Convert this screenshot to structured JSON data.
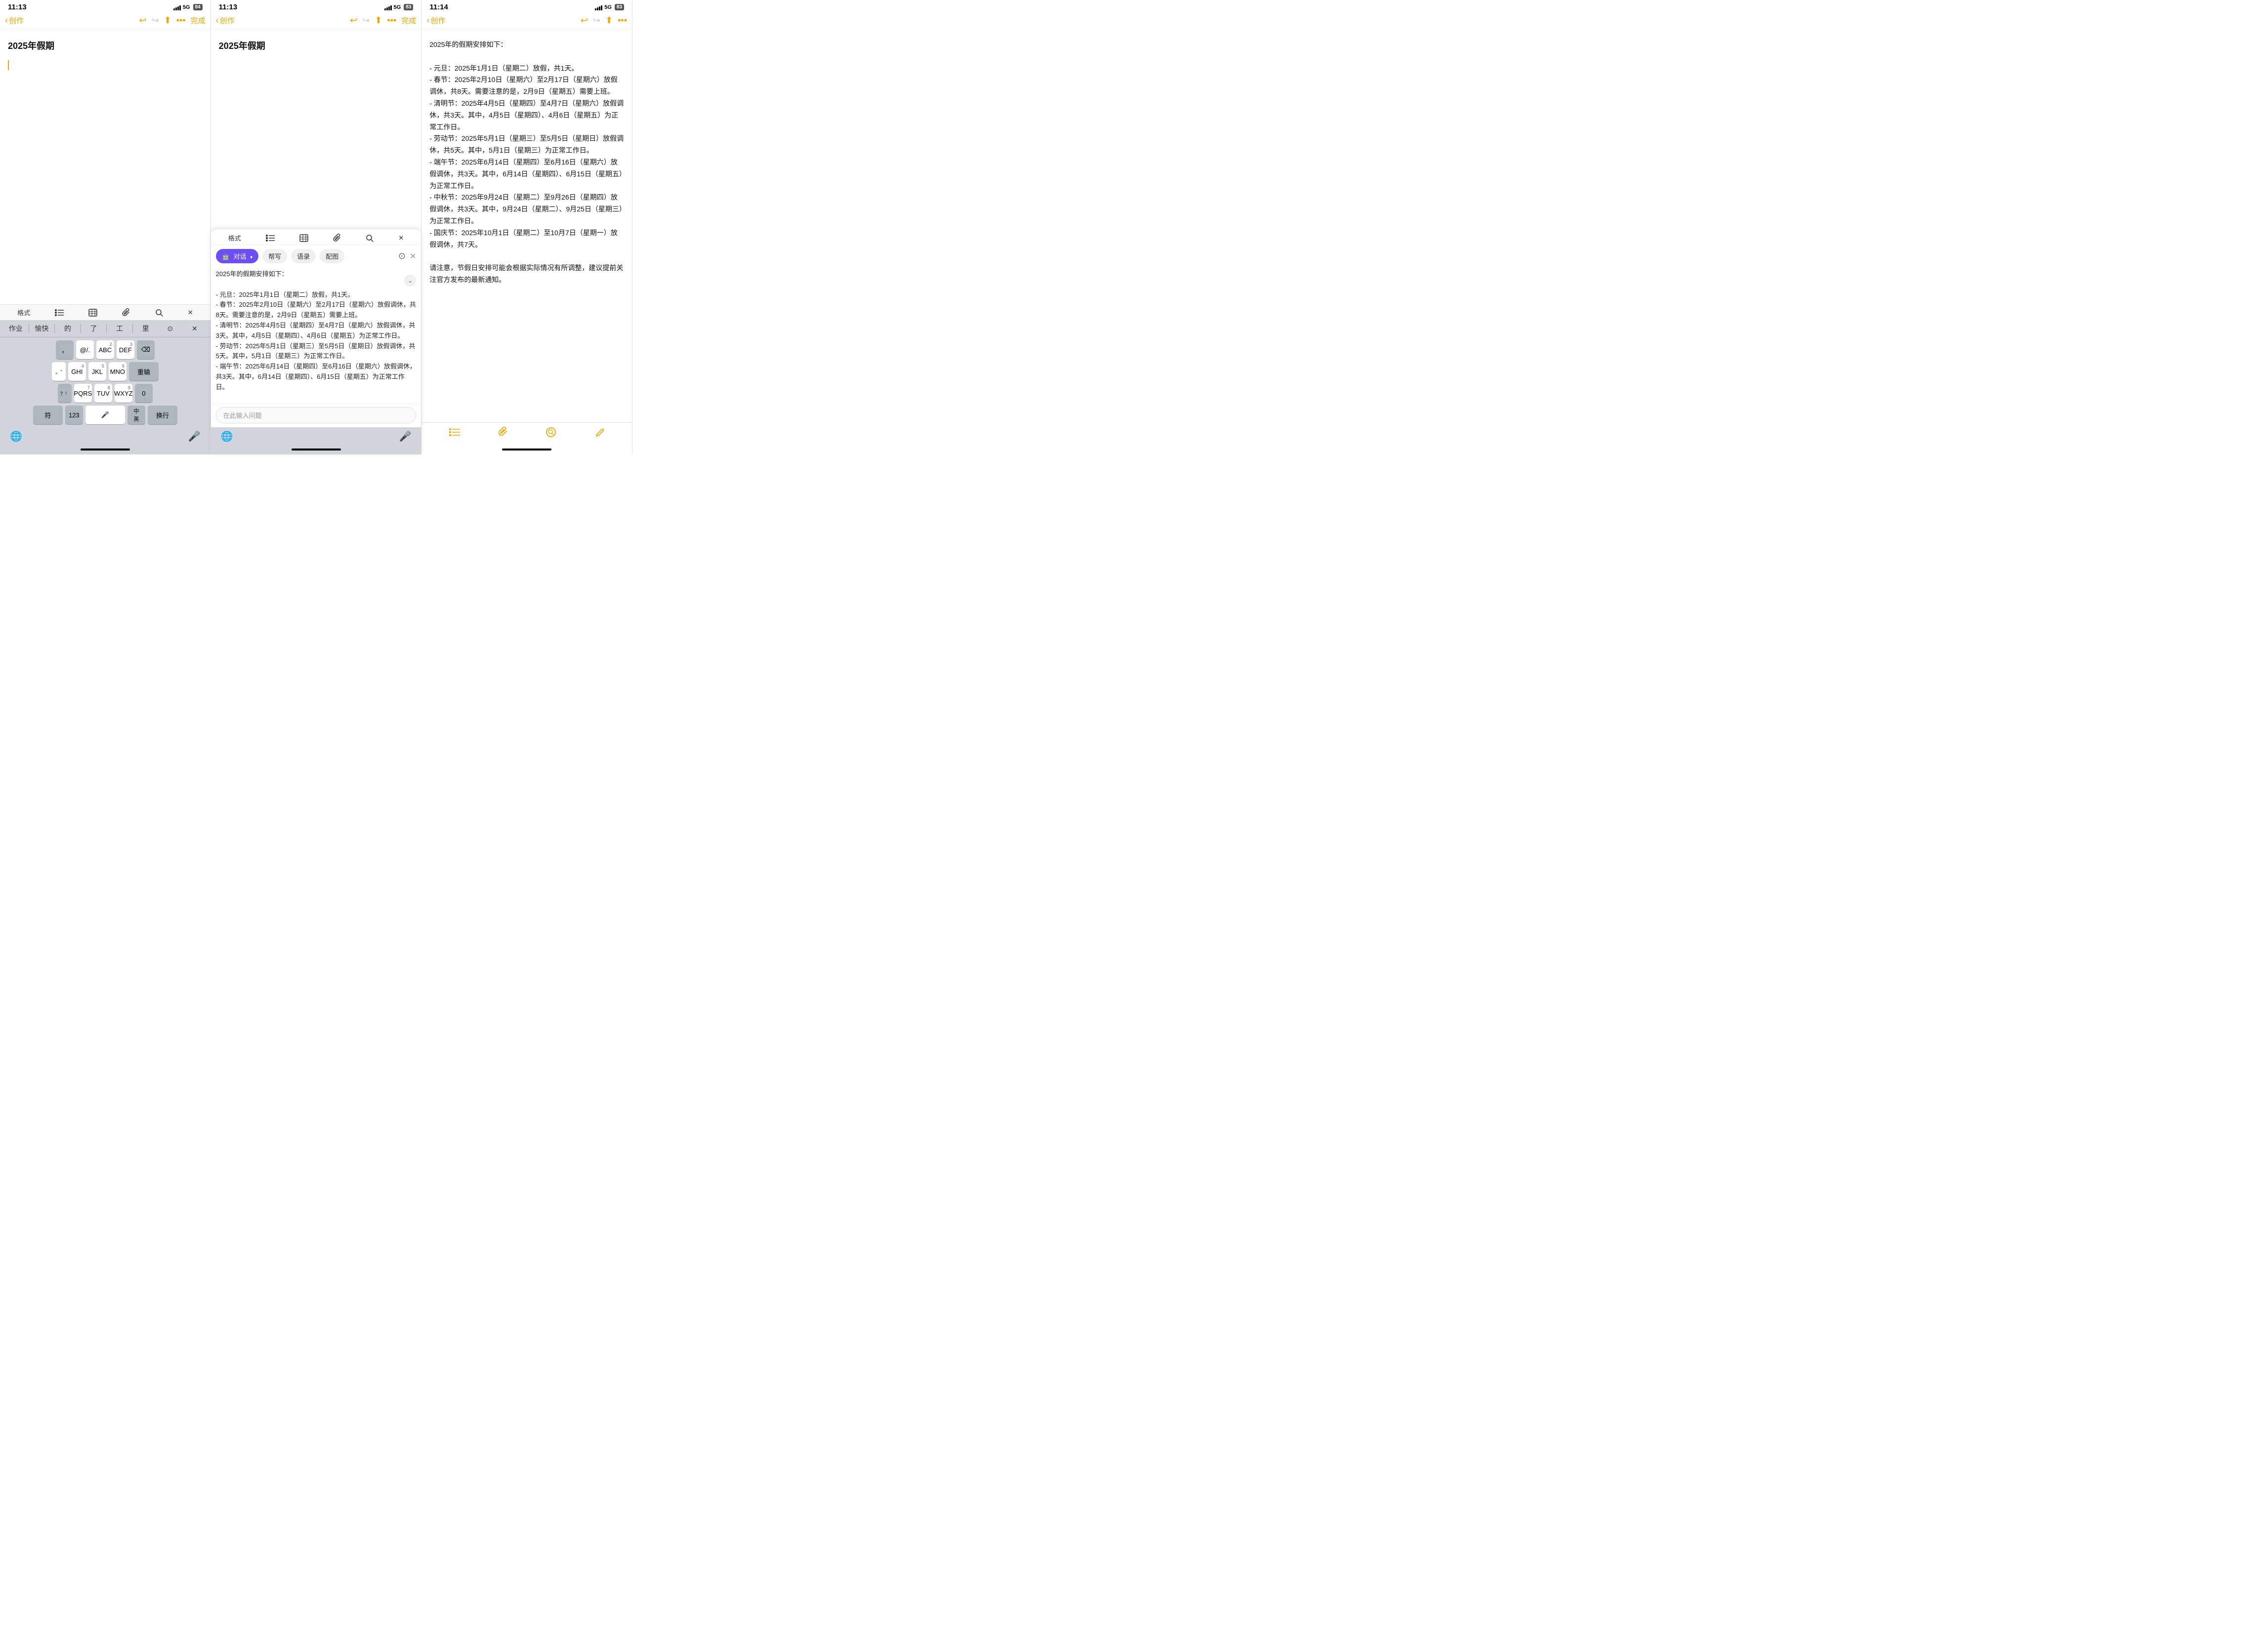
{
  "panels": [
    {
      "id": "panel1",
      "status": {
        "time": "11:13",
        "signal_label": "5G",
        "battery": "84"
      },
      "nav": {
        "back_label": "创作",
        "done_label": "完成"
      },
      "note": {
        "title": "2025年假期",
        "body": ""
      },
      "format_toolbar": [
        "格式",
        "列表",
        "表格",
        "附件",
        "搜索",
        "关闭"
      ],
      "keyboard": {
        "suggestions": [
          "作业",
          "愉快",
          "的",
          "了",
          "工",
          "里"
        ],
        "rows": [
          [
            "，",
            "@/.",
            "ABC",
            "DEF",
            "⌫"
          ],
          [
            "GHI",
            "JKL",
            "MNO",
            "重输"
          ],
          [
            "PQRS",
            "TUV",
            "WXYZ",
            "0"
          ],
          [
            "符",
            "123",
            "🎤",
            "中英",
            "换行"
          ]
        ]
      }
    },
    {
      "id": "panel2",
      "status": {
        "time": "11:13",
        "signal_label": "5G",
        "battery": "83"
      },
      "nav": {
        "back_label": "创作",
        "done_label": "完成"
      },
      "note": {
        "title": "2025年假期",
        "body": ""
      },
      "chat": {
        "toolbar": [
          "格式",
          "列表",
          "表格",
          "附件",
          "搜索",
          "关闭"
        ],
        "tabs": [
          "对话",
          "帮写",
          "语录",
          "配图"
        ],
        "messages": "2025年的假期安排如下：\n\n- 元旦：2025年1月1日（星期二）放假，共1天。\n- 春节：2025年2月10日（星期六）至2月17日（星期六）放假调休，共8天。需要注意的是，2月9日（星期五）需要上班。\n- 清明节：2025年4月5日（星期四）至4月7日（星期六）放假调休，共3天。其中，4月5日（星期四）、4月6日（星期五）为正常工作日。\n- 劳动节：2025年5月1日（星期三）至5月5日（星期日）放假调休，共5天。其中，5月1日（星期三）为正常工作日。\n- 端午节：2025年6月14日（星期四）至6月16日（星期六）放假调休，共3天。其中，6月14日（星期四）、6月15日（星期五）为正常工作日。",
        "input_placeholder": "在此输入问题"
      }
    },
    {
      "id": "panel3",
      "status": {
        "time": "11:14",
        "signal_label": "5G",
        "battery": "83"
      },
      "nav": {
        "back_label": "创作"
      },
      "note": {
        "title": "",
        "body": "2025年的假期安排如下：\n\n- 元旦：2025年1月1日（星期二）放假，共1天。\n- 春节：2025年2月10日（星期六）至2月17日（星期六）放假调休，共8天。需要注意的是，2月9日（星期五）需要上班。\n- 清明节：2025年4月5日（星期四）至4月7日（星期六）放假调休，共3天。其中，4月5日（星期四）、4月6日（星期五）为正常工作日。\n- 劳动节：2025年5月1日（星期三）至5月5日（星期日）放假调休，共5天。其中，5月1日（星期三）为正常工作日。\n- 端午节：2025年6月14日（星期四）至6月16日（星期六）放假调休，共3天。其中，6月14日（星期四）、6月15日（星期五）为正常工作日。\n- 中秋节：2025年9月24日（星期二）至9月26日（星期四）放假调休，共3天。其中，9月24日（星期二）、9月25日（星期三）为正常工作日。\n- 国庆节：2025年10月1日（星期二）至10月7日（星期一）放假调休，共7天。\n\n请注意，节假日安排可能会根据实际情况有所调整，建议提前关注官方发布的最新通知。"
      }
    }
  ],
  "icons": {
    "chevron_left": "‹",
    "undo": "↩",
    "redo": "↪",
    "share": "⬆",
    "more": "···",
    "close": "✕",
    "list": "☰",
    "table": "⊞",
    "attach": "⊕",
    "search": "⊙",
    "format": "格式",
    "camera": "⊙",
    "mic": "🎤",
    "globe": "🌐",
    "pencil": "✏",
    "scroll_down": "⌄",
    "checklist": "☑",
    "paperclip": "📎",
    "compose": "✏"
  },
  "colors": {
    "gold": "#f0a500",
    "purple": "#6b4ef6",
    "light_gray_key": "#adb5bd",
    "keyboard_bg": "#d1d5db"
  }
}
